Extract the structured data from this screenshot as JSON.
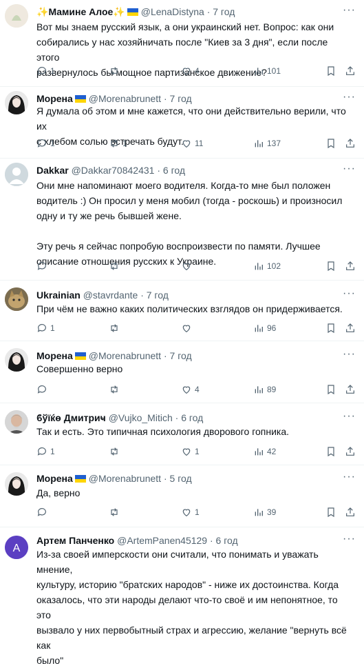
{
  "posts": [
    {
      "author": "Мамине Алое",
      "spark": "✨",
      "flag": true,
      "handle": "@LenaDistyna",
      "dot": "·",
      "time": "7 год",
      "text": "Вот мы знаем русский язык, а они украинский нет. Вопрос: как они\nсобирались у нас хозяйничать после \"Киев за 3 дня\", если после этого\nразвернулось бы мощное партизанское движение?",
      "replies": "1",
      "reposts": "",
      "likes": "4",
      "views": "101",
      "avatar": {
        "kind": "placeholder",
        "color": "#e6e0d6"
      }
    },
    {
      "author": "Морена",
      "flag": true,
      "handle": "@Morenabrunett",
      "dot": "·",
      "time": "7 год",
      "text": "Я думала об этом и мне кажется, что они действительно верили, что их\nс хлебом солью встречать будут.",
      "replies": "1",
      "reposts": "1",
      "likes": "11",
      "views": "137",
      "avatar": {
        "kind": "photo-dark"
      }
    },
    {
      "author": "Dakkar",
      "flag": false,
      "handle": "@Dakkar70842431",
      "dot": "·",
      "time": "6 год",
      "text": "Они мне напоминают моего водителя. Когда-то мне был положен\nводитель :) Он просил у меня мобил (тогда - роскошь) и произносил\nодну и ту же речь бывшей жене.\n\nЭту речь я сейчас попробую воспроизвести по памяти. Лучшее\nописание отношения русских к Украине.",
      "replies": "",
      "reposts": "",
      "likes": "",
      "views": "102",
      "avatar": {
        "kind": "default"
      }
    },
    {
      "author": "Ukrainian",
      "flag": false,
      "handle": "@stavrdante",
      "dot": "·",
      "time": "7 год",
      "text": "При чём не важно каких политических взглядов он придерживается.",
      "replies": "1",
      "reposts": "",
      "likes": "",
      "views": "96",
      "avatar": {
        "kind": "photo-cat"
      }
    },
    {
      "author": "Морена",
      "flag": true,
      "handle": "@Morenabrunett",
      "dot": "·",
      "time": "7 год",
      "text": "Совершенно верно",
      "replies": "",
      "reposts": "",
      "likes": "4",
      "views": "89",
      "avatar": {
        "kind": "photo-dark"
      }
    },
    {
      "author": "ϐўїќɵ Дмитриҹ",
      "flag": false,
      "handle": "@Vujko_Mitich",
      "dot": "·",
      "time": "6 год",
      "text": "Так и есть. Это типичная психология дворового гопника.",
      "replies": "1",
      "reposts": "",
      "likes": "1",
      "views": "42",
      "avatar": {
        "kind": "photo-man"
      }
    },
    {
      "author": "Морена",
      "flag": true,
      "handle": "@Morenabrunett",
      "dot": "·",
      "time": "5 год",
      "text": "Да, верно",
      "replies": "",
      "reposts": "",
      "likes": "1",
      "views": "39",
      "avatar": {
        "kind": "photo-dark"
      }
    },
    {
      "author": "Артем Панченко",
      "flag": false,
      "handle": "@ArtemPanen45129",
      "dot": "·",
      "time": "6 год",
      "text": "Из-за своей имперскости они считали, что понимать и уважать мнение,\nкультуру, историю \"братских народов\" - ниже их достоинства. Когда\nоказалось, что эти народы делают что-то своё и им непонятное, то это\nвызвало у них первобытный страх и агрессию, желание \"вернуть всё как\nбыло\"",
      "replies": "",
      "reposts": "",
      "likes": "",
      "views": "",
      "avatar": {
        "kind": "letter",
        "letter": "A",
        "color": "#5b3fc2"
      }
    }
  ],
  "colors": {
    "text": "#0f1419",
    "muted": "#536471",
    "divider": "#eff3f4"
  }
}
